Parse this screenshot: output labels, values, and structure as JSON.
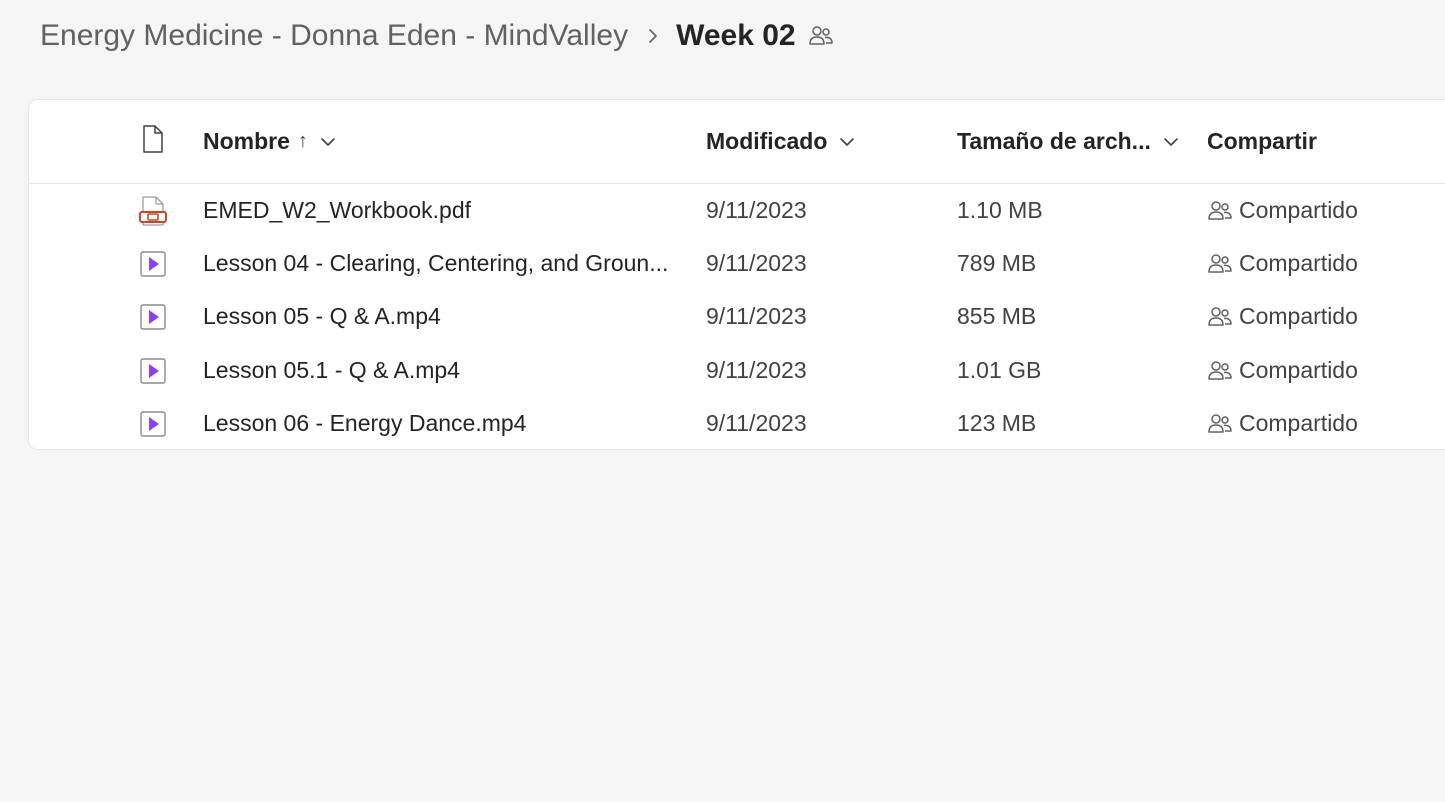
{
  "breadcrumb": {
    "parent": "Energy Medicine - Donna Eden - MindValley",
    "current": "Week 02",
    "shared_icon": "people-icon",
    "separator_icon": "chevron-right-icon"
  },
  "table": {
    "headers": {
      "type_icon": "file-icon",
      "name": "Nombre",
      "name_sort": "↑",
      "modified": "Modificado",
      "size": "Tamaño de arch...",
      "share": "Compartir"
    },
    "rows": [
      {
        "icon": "pdf-file-icon",
        "name": "EMED_W2_Workbook.pdf",
        "modified": "9/11/2023",
        "size": "1.10 MB",
        "share": "Compartido"
      },
      {
        "icon": "video-file-icon",
        "name": "Lesson 04 - Clearing, Centering, and Groun...",
        "modified": "9/11/2023",
        "size": "789 MB",
        "share": "Compartido"
      },
      {
        "icon": "video-file-icon",
        "name": "Lesson 05 - Q & A.mp4",
        "modified": "9/11/2023",
        "size": "855 MB",
        "share": "Compartido"
      },
      {
        "icon": "video-file-icon",
        "name": "Lesson 05.1 - Q & A.mp4",
        "modified": "9/11/2023",
        "size": "1.01 GB",
        "share": "Compartido"
      },
      {
        "icon": "video-file-icon",
        "name": "Lesson 06 - Energy Dance.mp4",
        "modified": "9/11/2023",
        "size": "123 MB",
        "share": "Compartido"
      }
    ]
  },
  "colors": {
    "background": "#f5f5f5",
    "card": "#ffffff",
    "pdf_accent": "#d04423",
    "video_accent": "#8a3ffc"
  }
}
